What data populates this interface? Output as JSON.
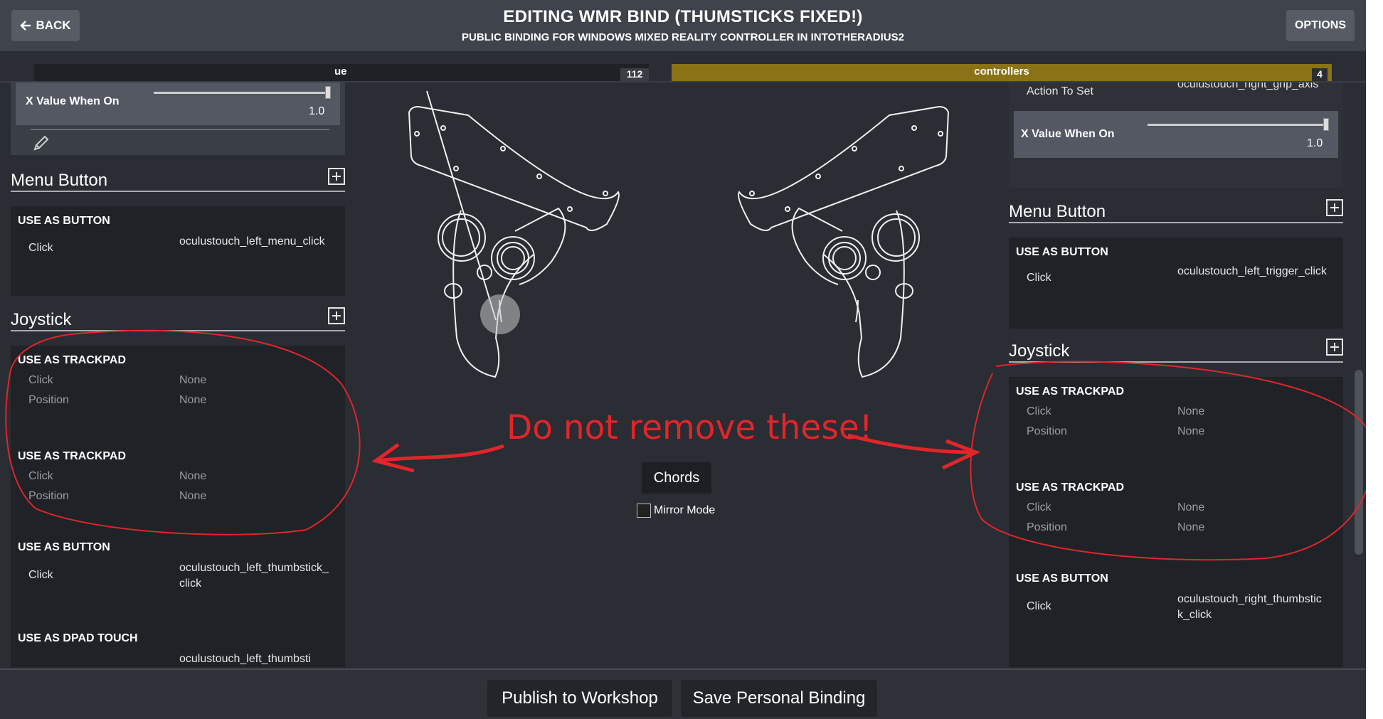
{
  "header": {
    "back_label": "BACK",
    "title": "EDITING WMR BIND (THUMSTICKS FIXED!)",
    "subtitle": "PUBLIC BINDING FOR WINDOWS MIXED REALITY CONTROLLER IN INTOTHERADIUS2",
    "options_label": "OPTIONS"
  },
  "tabs": {
    "left_label": "ue",
    "left_count": "112",
    "right_label": "controllers",
    "right_count": "4"
  },
  "left": {
    "slider": {
      "label": "X Value When On",
      "value": "1.0"
    },
    "menu": {
      "title": "Menu Button",
      "mode": "USE AS BUTTON",
      "rows": [
        {
          "key": "Click",
          "value": "oculustouch_left_menu_click"
        }
      ]
    },
    "joystick": {
      "title": "Joystick",
      "trackpad1": {
        "mode": "USE AS TRACKPAD",
        "click_key": "Click",
        "click_val": "None",
        "pos_key": "Position",
        "pos_val": "None"
      },
      "trackpad2": {
        "mode": "USE AS TRACKPAD",
        "click_key": "Click",
        "click_val": "None",
        "pos_key": "Position",
        "pos_val": "None"
      },
      "button": {
        "mode": "USE AS BUTTON",
        "click_key": "Click",
        "click_val": "oculustouch_left_thumbstick_click"
      },
      "dpad": {
        "mode": "USE AS DPAD TOUCH",
        "value": "oculustouch_left_thumbsti"
      }
    }
  },
  "right": {
    "action": {
      "key": "Action To Set",
      "value": "oculustouch_right_grip_axis"
    },
    "slider": {
      "label": "X Value When On",
      "value": "1.0"
    },
    "menu": {
      "title": "Menu Button",
      "mode": "USE AS BUTTON",
      "rows": [
        {
          "key": "Click",
          "value": "oculustouch_left_trigger_click"
        }
      ]
    },
    "joystick": {
      "title": "Joystick",
      "trackpad1": {
        "mode": "USE AS TRACKPAD",
        "click_key": "Click",
        "click_val": "None",
        "pos_key": "Position",
        "pos_val": "None"
      },
      "trackpad2": {
        "mode": "USE AS TRACKPAD",
        "click_key": "Click",
        "click_val": "None",
        "pos_key": "Position",
        "pos_val": "None"
      },
      "button": {
        "mode": "USE AS BUTTON",
        "click_key": "Click",
        "click_val": "oculustouch_right_thumbstick_click"
      }
    }
  },
  "middle": {
    "chords_label": "Chords",
    "mirror_label": "Mirror Mode",
    "annotation": "Do not remove these!"
  },
  "footer": {
    "publish_label": "Publish to Workshop",
    "save_label": "Save Personal Binding"
  },
  "colors": {
    "annotation_red": "#e0262a",
    "controllers_tab": "#8a7216",
    "header_bg": "#3f434b",
    "panel_bg": "#1f2227"
  },
  "icons": [
    "back-arrow-icon",
    "pencil-icon",
    "add-icon",
    "checkbox-icon"
  ]
}
